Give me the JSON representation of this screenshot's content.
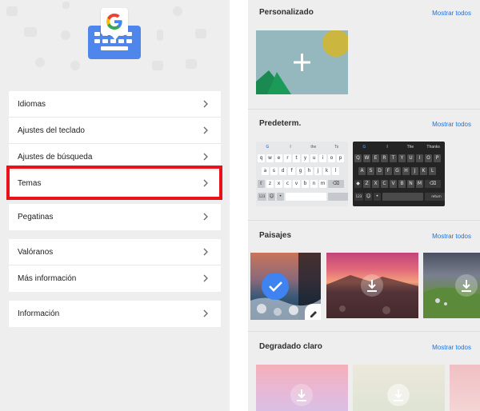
{
  "left_panel": {
    "menu_groups": [
      {
        "items": [
          {
            "label": "Idiomas"
          },
          {
            "label": "Ajustes del teclado"
          },
          {
            "label": "Ajustes de búsqueda"
          },
          {
            "label": "Temas"
          }
        ]
      },
      {
        "items": [
          {
            "label": "Pegatinas"
          }
        ]
      },
      {
        "items": [
          {
            "label": "Valóranos"
          },
          {
            "label": "Más información"
          }
        ]
      },
      {
        "items": [
          {
            "label": "Información"
          }
        ]
      }
    ],
    "highlighted_item": "Temas",
    "highlight_color": "#e8121a"
  },
  "right_panel": {
    "sections": [
      {
        "title": "Personalizado",
        "link": "Mostrar todos"
      },
      {
        "title": "Predeterm.",
        "link": "Mostrar todos"
      },
      {
        "title": "Paisajes",
        "link": "Mostrar todos"
      },
      {
        "title": "Degradado claro",
        "link": "Mostrar todos"
      }
    ],
    "keyboard_light": {
      "suggestions": [
        "I",
        "the",
        "Ts"
      ],
      "rows": [
        [
          "q",
          "w",
          "e",
          "r",
          "t",
          "y",
          "u",
          "i",
          "o",
          "p"
        ],
        [
          "a",
          "s",
          "d",
          "f",
          "g",
          "h",
          "j",
          "k",
          "l"
        ],
        [
          "z",
          "x",
          "c",
          "v",
          "b",
          "n",
          "m"
        ]
      ],
      "bottom_left": "123"
    },
    "keyboard_dark": {
      "suggestions": [
        "I",
        "The",
        "Thanks"
      ],
      "rows": [
        [
          "Q",
          "W",
          "E",
          "R",
          "T",
          "Y",
          "U",
          "I",
          "O",
          "P"
        ],
        [
          "A",
          "S",
          "D",
          "F",
          "G",
          "H",
          "J",
          "K",
          "L"
        ],
        [
          "Z",
          "X",
          "C",
          "V",
          "B",
          "N",
          "M"
        ]
      ],
      "bottom_left": "123",
      "return_label": "return"
    },
    "accent_color": "#1a73e8",
    "selected_theme_color": "#3f83f0"
  }
}
